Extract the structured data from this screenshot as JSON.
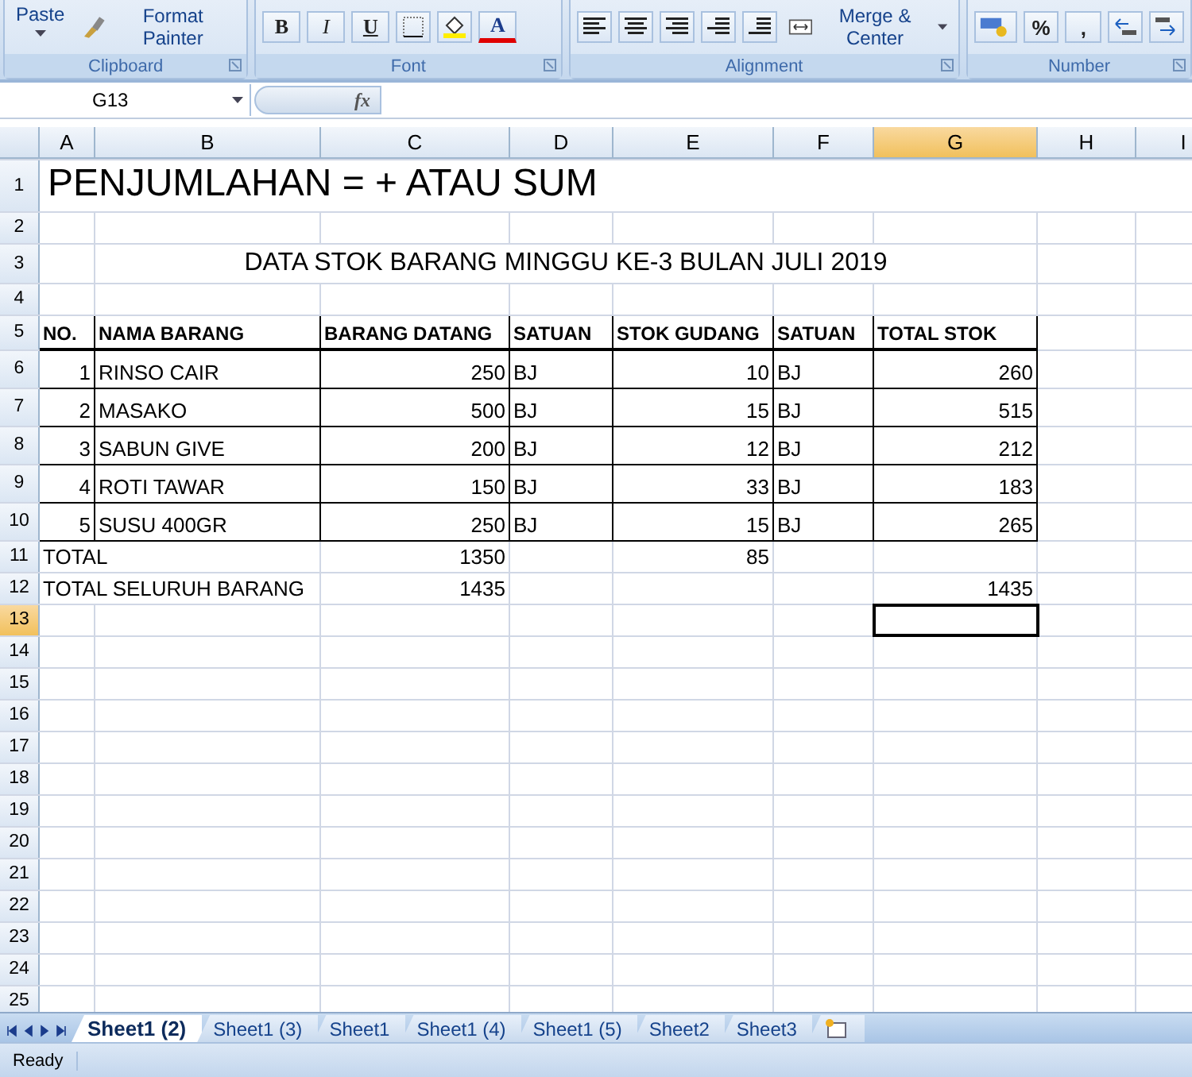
{
  "ribbon": {
    "groups": [
      {
        "label": "Clipboard"
      },
      {
        "label": "Font"
      },
      {
        "label": "Alignment"
      },
      {
        "label": "Number"
      }
    ],
    "clipboard": {
      "paste": "Paste",
      "format_painter": "Format Painter"
    },
    "font": {
      "bold": "B",
      "italic": "I",
      "underline": "U",
      "font_color": "A"
    },
    "alignment": {
      "merge": "Merge & Center"
    },
    "number": {
      "percent": "%",
      "comma": ","
    }
  },
  "formula_bar": {
    "name_box": "G13",
    "fx": "fx"
  },
  "columns": [
    {
      "label": "A",
      "selected": false
    },
    {
      "label": "B",
      "selected": false
    },
    {
      "label": "C",
      "selected": false
    },
    {
      "label": "D",
      "selected": false
    },
    {
      "label": "E",
      "selected": false
    },
    {
      "label": "F",
      "selected": false
    },
    {
      "label": "G",
      "selected": true
    },
    {
      "label": "H",
      "selected": false
    },
    {
      "label": "I",
      "selected": false
    }
  ],
  "rows": [
    {
      "label": "1",
      "selected": false,
      "kind": "title",
      "cells": [
        {
          "text": "PENJUMLAHAN = + ATAU SUM",
          "kind": "text"
        },
        null,
        null,
        null,
        null,
        null,
        null,
        null,
        null
      ]
    },
    {
      "label": "2",
      "selected": false,
      "kind": "plain",
      "cells": [
        null,
        null,
        null,
        null,
        null,
        null,
        null,
        null,
        null
      ]
    },
    {
      "label": "3",
      "selected": false,
      "kind": "caption",
      "cells": [
        null,
        {
          "text": "DATA STOK BARANG MINGGU KE-3 BULAN JULI 2019",
          "kind": "text"
        },
        null,
        null,
        null,
        null,
        null,
        null,
        null
      ]
    },
    {
      "label": "4",
      "selected": false,
      "kind": "plain",
      "cells": [
        null,
        null,
        null,
        null,
        null,
        null,
        null,
        null,
        null
      ]
    },
    {
      "label": "5",
      "selected": false,
      "kind": "header",
      "cells": [
        {
          "text": "NO.",
          "kind": "text"
        },
        {
          "text": "NAMA BARANG",
          "kind": "text"
        },
        {
          "text": "BARANG DATANG",
          "kind": "text"
        },
        {
          "text": "SATUAN",
          "kind": "text"
        },
        {
          "text": "STOK GUDANG",
          "kind": "text"
        },
        {
          "text": "SATUAN",
          "kind": "text"
        },
        {
          "text": "TOTAL STOK",
          "kind": "text"
        },
        null,
        null
      ]
    },
    {
      "label": "6",
      "selected": false,
      "kind": "table",
      "cells": [
        {
          "text": "1",
          "kind": "number"
        },
        {
          "text": "RINSO CAIR",
          "kind": "text"
        },
        {
          "text": "250",
          "kind": "number"
        },
        {
          "text": "BJ",
          "kind": "text"
        },
        {
          "text": "10",
          "kind": "number"
        },
        {
          "text": "BJ",
          "kind": "text"
        },
        {
          "text": "260",
          "kind": "number"
        },
        null,
        null
      ]
    },
    {
      "label": "7",
      "selected": false,
      "kind": "table",
      "cells": [
        {
          "text": "2",
          "kind": "number"
        },
        {
          "text": "MASAKO",
          "kind": "text"
        },
        {
          "text": "500",
          "kind": "number"
        },
        {
          "text": "BJ",
          "kind": "text"
        },
        {
          "text": "15",
          "kind": "number"
        },
        {
          "text": "BJ",
          "kind": "text"
        },
        {
          "text": "515",
          "kind": "number"
        },
        null,
        null
      ]
    },
    {
      "label": "8",
      "selected": false,
      "kind": "table",
      "cells": [
        {
          "text": "3",
          "kind": "number"
        },
        {
          "text": "SABUN GIVE",
          "kind": "text"
        },
        {
          "text": "200",
          "kind": "number"
        },
        {
          "text": "BJ",
          "kind": "text"
        },
        {
          "text": "12",
          "kind": "number"
        },
        {
          "text": "BJ",
          "kind": "text"
        },
        {
          "text": "212",
          "kind": "number"
        },
        null,
        null
      ]
    },
    {
      "label": "9",
      "selected": false,
      "kind": "table",
      "cells": [
        {
          "text": "4",
          "kind": "number"
        },
        {
          "text": "ROTI TAWAR",
          "kind": "text"
        },
        {
          "text": "150",
          "kind": "number"
        },
        {
          "text": "BJ",
          "kind": "text"
        },
        {
          "text": "33",
          "kind": "number"
        },
        {
          "text": "BJ",
          "kind": "text"
        },
        {
          "text": "183",
          "kind": "number"
        },
        null,
        null
      ]
    },
    {
      "label": "10",
      "selected": false,
      "kind": "table",
      "cells": [
        {
          "text": "5",
          "kind": "number"
        },
        {
          "text": "SUSU 400GR",
          "kind": "text"
        },
        {
          "text": "250",
          "kind": "number"
        },
        {
          "text": "BJ",
          "kind": "text"
        },
        {
          "text": "15",
          "kind": "number"
        },
        {
          "text": "BJ",
          "kind": "text"
        },
        {
          "text": "265",
          "kind": "number"
        },
        null,
        null
      ]
    },
    {
      "label": "11",
      "selected": false,
      "kind": "plain",
      "cells": [
        {
          "text": "TOTAL",
          "kind": "text"
        },
        null,
        {
          "text": "1350",
          "kind": "number"
        },
        null,
        {
          "text": "85",
          "kind": "number"
        },
        null,
        null,
        null,
        null
      ]
    },
    {
      "label": "12",
      "selected": false,
      "kind": "plain",
      "cells": [
        {
          "text": "TOTAL SELURUH BARANG",
          "kind": "text"
        },
        null,
        {
          "text": "1435",
          "kind": "number"
        },
        null,
        null,
        null,
        {
          "text": "1435",
          "kind": "number"
        },
        null,
        null
      ]
    },
    {
      "label": "13",
      "selected": true,
      "kind": "plain",
      "cells": [
        null,
        null,
        null,
        null,
        null,
        null,
        null,
        null,
        null
      ]
    },
    {
      "label": "14",
      "selected": false,
      "kind": "plain",
      "cells": [
        null,
        null,
        null,
        null,
        null,
        null,
        null,
        null,
        null
      ]
    },
    {
      "label": "15",
      "selected": false,
      "kind": "plain",
      "cells": [
        null,
        null,
        null,
        null,
        null,
        null,
        null,
        null,
        null
      ]
    },
    {
      "label": "16",
      "selected": false,
      "kind": "plain",
      "cells": [
        null,
        null,
        null,
        null,
        null,
        null,
        null,
        null,
        null
      ]
    },
    {
      "label": "17",
      "selected": false,
      "kind": "plain",
      "cells": [
        null,
        null,
        null,
        null,
        null,
        null,
        null,
        null,
        null
      ]
    },
    {
      "label": "18",
      "selected": false,
      "kind": "plain",
      "cells": [
        null,
        null,
        null,
        null,
        null,
        null,
        null,
        null,
        null
      ]
    },
    {
      "label": "19",
      "selected": false,
      "kind": "plain",
      "cells": [
        null,
        null,
        null,
        null,
        null,
        null,
        null,
        null,
        null
      ]
    },
    {
      "label": "20",
      "selected": false,
      "kind": "plain",
      "cells": [
        null,
        null,
        null,
        null,
        null,
        null,
        null,
        null,
        null
      ]
    },
    {
      "label": "21",
      "selected": false,
      "kind": "plain",
      "cells": [
        null,
        null,
        null,
        null,
        null,
        null,
        null,
        null,
        null
      ]
    },
    {
      "label": "22",
      "selected": false,
      "kind": "plain",
      "cells": [
        null,
        null,
        null,
        null,
        null,
        null,
        null,
        null,
        null
      ]
    },
    {
      "label": "23",
      "selected": false,
      "kind": "plain",
      "cells": [
        null,
        null,
        null,
        null,
        null,
        null,
        null,
        null,
        null
      ]
    },
    {
      "label": "24",
      "selected": false,
      "kind": "plain",
      "cells": [
        null,
        null,
        null,
        null,
        null,
        null,
        null,
        null,
        null
      ]
    },
    {
      "label": "25",
      "selected": false,
      "kind": "plain",
      "cells": [
        null,
        null,
        null,
        null,
        null,
        null,
        null,
        null,
        null
      ]
    }
  ],
  "sheet_tabs": [
    {
      "label": "Sheet1 (2)",
      "selected": true
    },
    {
      "label": "Sheet1 (3)",
      "selected": false
    },
    {
      "label": "Sheet1",
      "selected": false
    },
    {
      "label": "Sheet1 (4)",
      "selected": false
    },
    {
      "label": "Sheet1 (5)",
      "selected": false
    },
    {
      "label": "Sheet2",
      "selected": false
    },
    {
      "label": "Sheet3",
      "selected": false
    }
  ],
  "status_bar": {
    "text": "Ready"
  }
}
